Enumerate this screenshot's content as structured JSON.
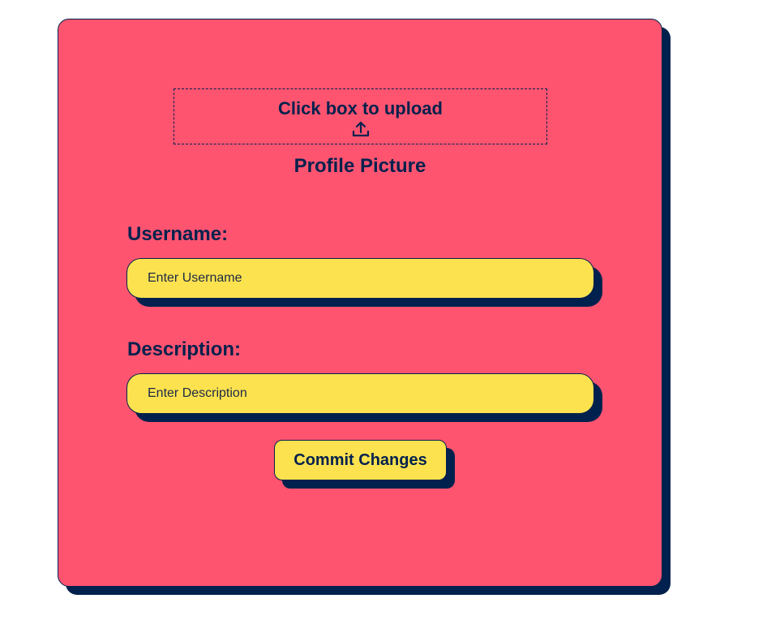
{
  "upload": {
    "label": "Click box to upload",
    "icon": "upload-icon"
  },
  "profile_picture": {
    "label": "Profile Picture"
  },
  "username": {
    "label": "Username:",
    "placeholder": "Enter Username",
    "value": ""
  },
  "description": {
    "label": "Description:",
    "placeholder": "Enter Description",
    "value": ""
  },
  "commit": {
    "label": "Commit Changes"
  },
  "colors": {
    "card_background": "#ff5470",
    "input_background": "#fde24f",
    "text_and_shadow": "#00214d",
    "page_background": "#ffffff"
  }
}
